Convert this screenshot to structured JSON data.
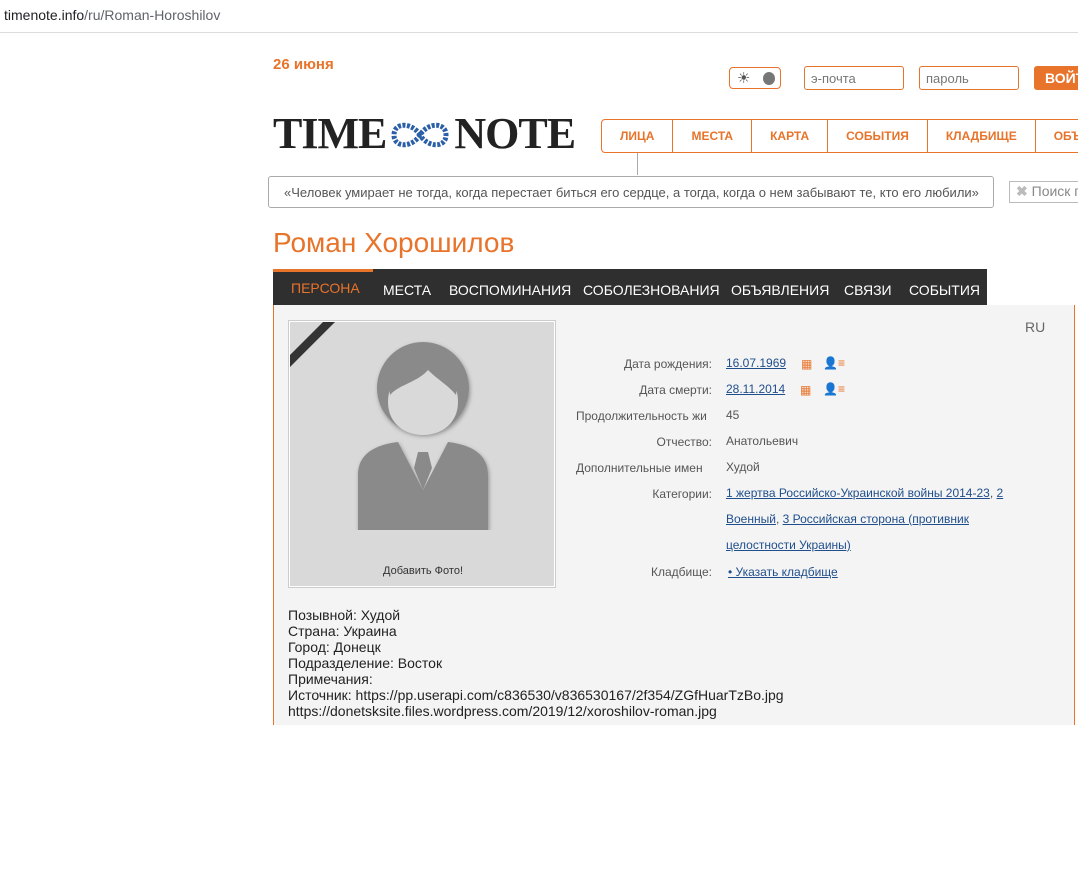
{
  "browser": {
    "url_host": "timenote.info",
    "url_path": "/ru/Roman-Horoshilov"
  },
  "header": {
    "date": "26 июня",
    "email_placeholder": "э-почта",
    "password_placeholder": "пароль",
    "login_label": "ВОЙТ",
    "logo_left": "TIME",
    "logo_right": "NOTE"
  },
  "nav": {
    "items": [
      "ЛИЦА",
      "МЕСТА",
      "КАРТА",
      "СОБЫТИЯ",
      "КЛАДБИЩЕ",
      "ОБЪ"
    ]
  },
  "quote": "«Человек умирает не тогда, когда перестает биться его сердце, а тогда, когда о нем забывают те, кто его любили»",
  "search_placeholder": "Поиск п",
  "person": {
    "name": "Роман Хорошилов"
  },
  "tabs": [
    "ПЕРСОНА",
    "МЕСТА",
    "ВОСПОМИНАНИЯ",
    "СОБОЛЕЗНОВАНИЯ",
    "ОБЪЯВЛЕНИЯ",
    "СВЯЗИ",
    "СОБЫТИЯ"
  ],
  "lang": "RU",
  "photo": {
    "add_label": "Добавить Фото!"
  },
  "details": {
    "birth_label": "Дата рождения:",
    "birth_value": "16.07.1969",
    "death_label": "Дата смерти:",
    "death_value": "28.11.2014",
    "duration_label": "Продолжительность жи",
    "duration_value": "45",
    "patronymic_label": "Отчество:",
    "patronymic_value": "Анатольевич",
    "extra_names_label": "Дополнительные имен",
    "extra_names_value": "Худой",
    "categories_label": "Категории:",
    "cat1": "1 жертва Российско-Украинской войны 2014-23",
    "cat2a": "2",
    "cat2b": "Военный",
    "cat3a": "3 Российская сторона (противник",
    "cat3b": "целостности Украины)",
    "cemetery_label": "Кладбище:",
    "cemetery_value": "• Указать кладбище"
  },
  "notes": [
    "Позывной: Худой",
    "Страна: Украина",
    "Город: Донецк",
    "Подразделение: Восток",
    "Примечания:",
    "Источник: https://pp.userapi.com/c836530/v836530167/2f354/ZGfHuarTzBo.jpg",
    "https://donetsksite.files.wordpress.com/2019/12/xoroshilov-roman.jpg"
  ],
  "colors": {
    "accent": "#e8732a",
    "tabbar": "#2f2f2f",
    "link": "#1f4e8c"
  },
  "icons": [
    "sun-icon",
    "moon-icon",
    "infinity-icon",
    "calendar-icon",
    "person-list-icon",
    "close-icon",
    "avatar-placeholder-icon"
  ]
}
